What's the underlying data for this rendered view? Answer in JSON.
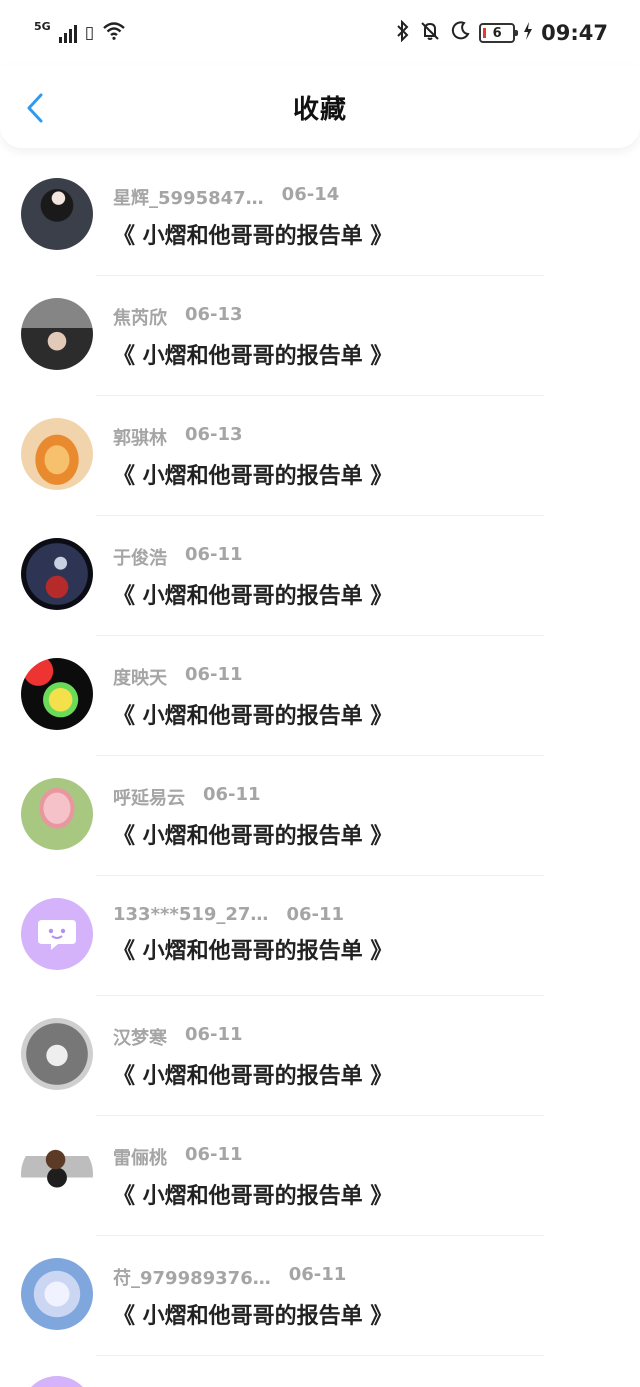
{
  "status_bar": {
    "network": "5G",
    "wifi_badge": "6",
    "battery": "6",
    "time": "09:47",
    "icons": [
      "signal-icon",
      "sim-icon",
      "wifi-icon",
      "bluetooth-icon",
      "mute-icon",
      "moon-icon",
      "battery-icon",
      "charging-icon"
    ]
  },
  "header": {
    "title": "收藏",
    "back_icon": "chevron-left-icon",
    "accent": "#2f9bf0"
  },
  "items": [
    {
      "user": "星辉_5995847…",
      "date": "06-14",
      "title": "《 小熠和他哥哥的报告单 》",
      "avatar_color": "#4a4f5c"
    },
    {
      "user": "焦芮欣",
      "date": "06-13",
      "title": "《 小熠和他哥哥的报告单 》",
      "avatar_color": "#6c6c6c"
    },
    {
      "user": "郭骐林",
      "date": "06-13",
      "title": "《 小熠和他哥哥的报告单 》",
      "avatar_color": "#f0a24a"
    },
    {
      "user": "于俊浩",
      "date": "06-11",
      "title": "《 小熠和他哥哥的报告单 》",
      "avatar_color": "#2a2c3f"
    },
    {
      "user": "度映天",
      "date": "06-11",
      "title": "《 小熠和他哥哥的报告单 》",
      "avatar_color": "#111111"
    },
    {
      "user": "呼延易云",
      "date": "06-11",
      "title": "《 小熠和他哥哥的报告单 》",
      "avatar_color": "#7fae5d"
    },
    {
      "user": "133***519_27…",
      "date": "06-11",
      "title": "《 小熠和他哥哥的报告单 》",
      "avatar_color": "#d4b3fa"
    },
    {
      "user": "汉梦寒",
      "date": "06-11",
      "title": "《 小熠和他哥哥的报告单 》",
      "avatar_color": "#8f8f8f"
    },
    {
      "user": "雷俪桃",
      "date": "06-11",
      "title": "《 小熠和他哥哥的报告单 》",
      "avatar_color": "#c9c9c9"
    },
    {
      "user": "苻_979989376…",
      "date": "06-11",
      "title": "《 小熠和他哥哥的报告单 》",
      "avatar_color": "#9ec1e8"
    }
  ]
}
